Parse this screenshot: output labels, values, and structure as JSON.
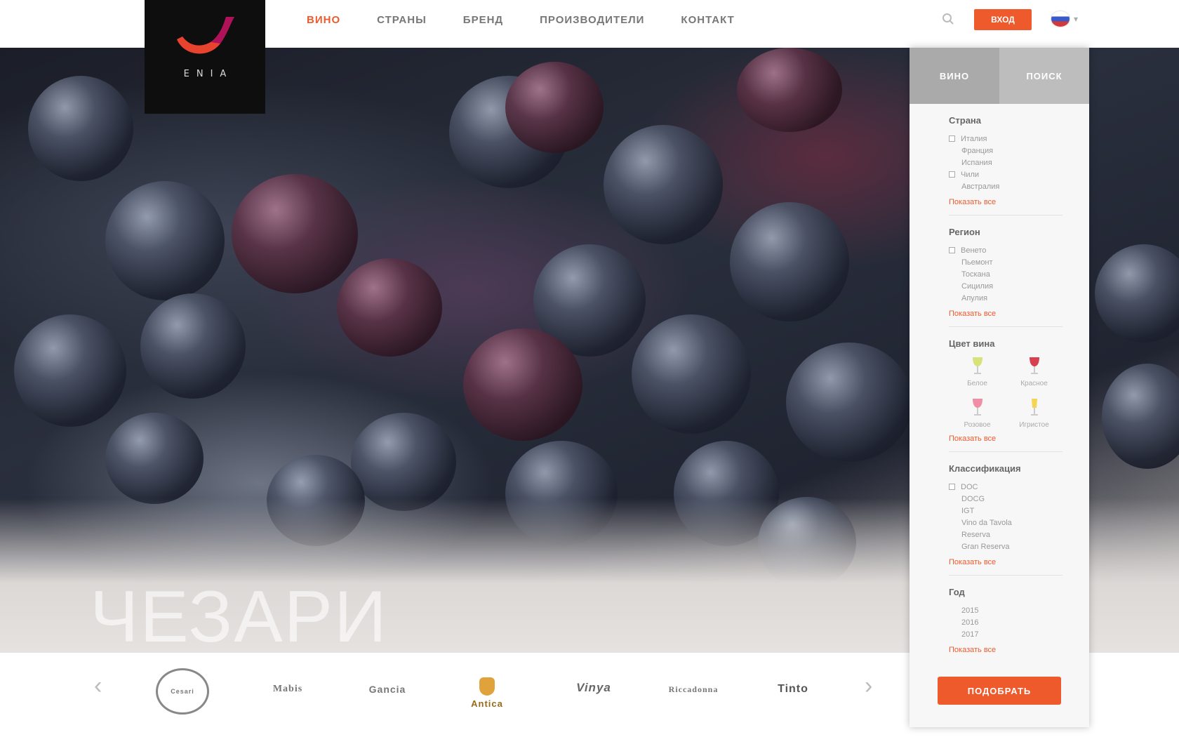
{
  "header": {
    "logo_text": "ENIA",
    "nav": [
      {
        "label": "ВИНО",
        "active": true
      },
      {
        "label": "СТРАНЫ",
        "active": false
      },
      {
        "label": "БРЕНД",
        "active": false
      },
      {
        "label": "ПРОИЗВОДИТЕЛИ",
        "active": false
      },
      {
        "label": "КОНТАКТ",
        "active": false
      }
    ],
    "search_icon": "search-icon",
    "cta_label": "ВХОД",
    "language": "RU",
    "accent_color": "#ef5a2d"
  },
  "hero": {
    "title": "ЧЕЗАРИ"
  },
  "filter": {
    "tabs": [
      "ВИНО",
      "ПОИСК"
    ],
    "sections": [
      {
        "title": "Страна",
        "options": [
          "Италия",
          "Франция",
          "Испания",
          "Чили",
          "Австралия"
        ],
        "more": "Показать все"
      },
      {
        "title": "Регион",
        "options": [
          "Венето",
          "Пьемонт",
          "Тоскана",
          "Сицилия",
          "Апулия"
        ],
        "more": "Показать все"
      },
      {
        "title": "Цвет вина",
        "colors": [
          {
            "label": "Белое",
            "icon": "white-wine-glass-icon",
            "color": "#d8e27a"
          },
          {
            "label": "Красное",
            "icon": "red-wine-glass-icon",
            "color": "#d8404f"
          },
          {
            "label": "Розовое",
            "icon": "rose-wine-glass-icon",
            "color": "#ee8fa6"
          },
          {
            "label": "Игристое",
            "icon": "sparkling-wine-glass-icon",
            "color": "#f3d453"
          }
        ],
        "more": "Показать все"
      },
      {
        "title": "Классификация",
        "options": [
          "DOC",
          "DOCG",
          "IGT",
          "Vino da Tavola",
          "Reserva",
          "Gran Reserva"
        ],
        "more": "Показать все"
      },
      {
        "title": "Год",
        "options": [
          "2015",
          "2016",
          "2017"
        ],
        "more": "Показать все"
      }
    ],
    "apply_label": "ПОДОБРАТЬ"
  },
  "brands": {
    "items": [
      "Cesari",
      "Mabis",
      "Gancia",
      "Antica",
      "Vinya",
      "Riccadonna",
      "Tinto"
    ]
  }
}
